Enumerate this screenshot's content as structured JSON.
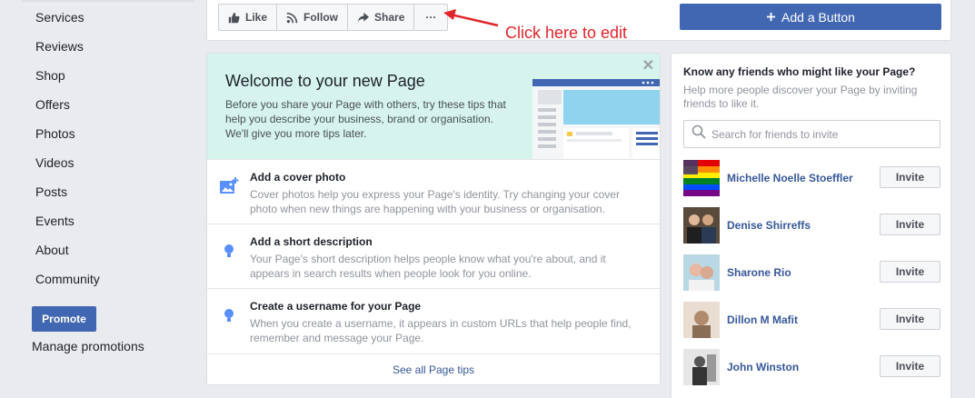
{
  "nav": {
    "items": [
      "Services",
      "Reviews",
      "Shop",
      "Offers",
      "Photos",
      "Videos",
      "Posts",
      "Events",
      "About",
      "Community"
    ],
    "promote_label": "Promote",
    "manage_label": "Manage promotions"
  },
  "actions": {
    "like": "Like",
    "follow": "Follow",
    "share": "Share",
    "more": "···",
    "add_button": "Add a Button",
    "add_button_icon": "plus-icon"
  },
  "annotation": {
    "text": "Click here to edit",
    "color": "#e1252a"
  },
  "welcome": {
    "title": "Welcome to your new Page",
    "description": "Before you share your Page with others, try these tips that help you describe your business, brand or organisation. We'll give you more tips later.",
    "close": "✕"
  },
  "tips": [
    {
      "title": "Add a cover photo",
      "description": "Cover photos help you express your Page's identity. Try changing your cover photo when new things are happening with your business or organisation.",
      "icon": "add-photo-icon"
    },
    {
      "title": "Add a short description",
      "description": "Your Page's short description helps people know what you're about, and it appears in search results when people look for you online.",
      "icon": "lightbulb-icon"
    },
    {
      "title": "Create a username for your Page",
      "description": "When you create a username, it appears in custom URLs that help people find, remember and message your Page.",
      "icon": "lightbulb-icon"
    }
  ],
  "see_all": "See all Page tips",
  "invite": {
    "title": "Know any friends who might like your Page?",
    "description": "Help more people discover your Page by inviting friends to like it.",
    "search_placeholder": "Search for friends to invite",
    "button_label": "Invite",
    "friends": [
      {
        "name": "Michelle Noelle Stoeffler"
      },
      {
        "name": "Denise Shirreffs"
      },
      {
        "name": "Sharone Rio"
      },
      {
        "name": "Dillon M Mafit"
      },
      {
        "name": "John Winston"
      }
    ]
  },
  "colors": {
    "brand": "#4267b2",
    "link": "#365899",
    "banner": "#d6f3ee"
  }
}
